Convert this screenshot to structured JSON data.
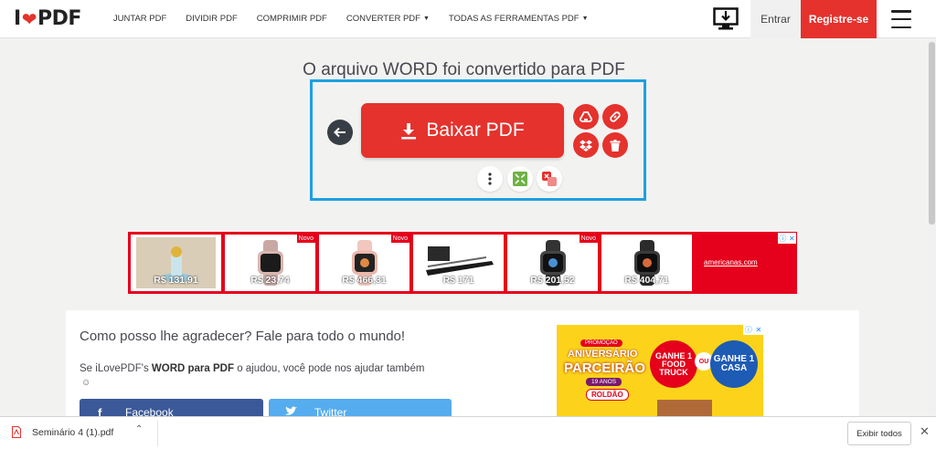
{
  "header": {
    "logo_left": "I",
    "logo_right": "PDF",
    "nav": [
      {
        "label": "JUNTAR PDF"
      },
      {
        "label": "DIVIDIR PDF"
      },
      {
        "label": "COMPRIMIR PDF"
      },
      {
        "label": "CONVERTER PDF"
      },
      {
        "label": "TODAS AS FERRAMENTAS PDF"
      }
    ],
    "login": "Entrar",
    "signup": "Registre-se"
  },
  "main": {
    "title": "O arquivo WORD foi convertido para PDF",
    "download_label": "Baixar PDF"
  },
  "ad": {
    "prices": [
      "R$ 131,91",
      "R$ 23,74",
      "R$ 466,31",
      "R$ 171",
      "R$ 201,52",
      "R$ 404,71"
    ],
    "novo": "Novo",
    "brand": "americanas.com"
  },
  "card": {
    "title": "Como posso lhe agradecer? Fale para todo o mundo!",
    "text_prefix": "Se iLovePDF's ",
    "text_bold": "WORD para PDF",
    "text_suffix": " o ajudou, você pode nos ajudar também",
    "smiley": "☺",
    "facebook": "Facebook",
    "twitter": "Twitter"
  },
  "promo": {
    "line1": "PROMOÇÃO",
    "line2": "ANIVERSÁRIO",
    "line3": "PARCEIRÃO",
    "line4": "19 ANOS",
    "line5": "ROLDÃO",
    "badge1": "GANHE 1 FOOD TRUCK",
    "ou": "OU",
    "badge2": "GANHE 1 CASA"
  },
  "downloads": {
    "file_name": "Seminário 4 (1).pdf",
    "show_all": "Exibir todos"
  },
  "colors": {
    "brand_red": "#e5322d",
    "highlight_blue": "#1ea0e0"
  }
}
